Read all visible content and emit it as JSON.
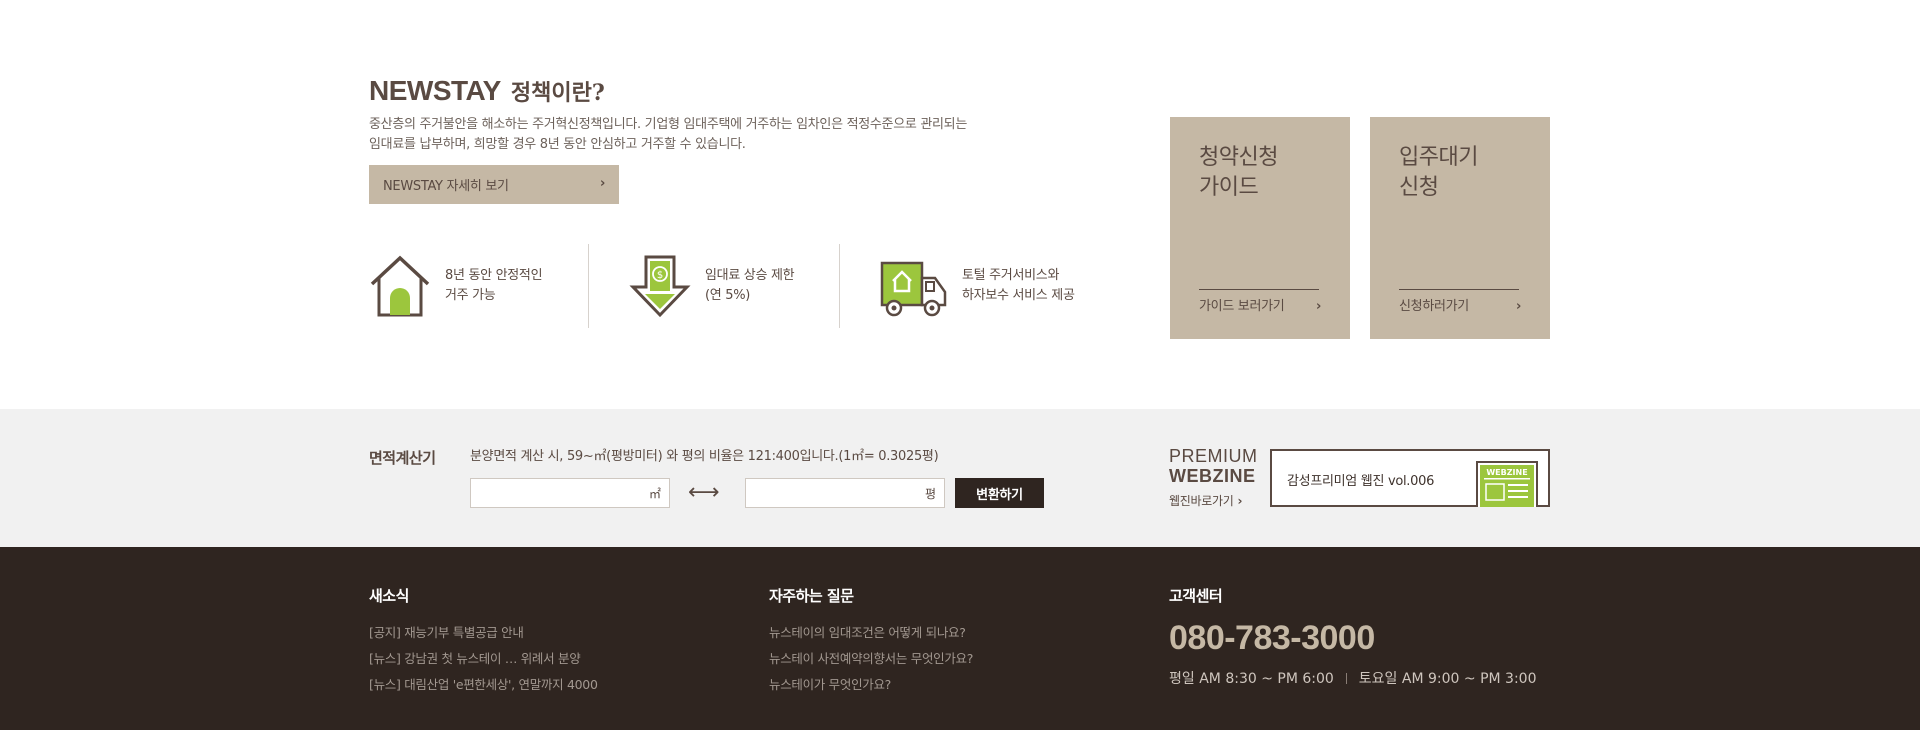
{
  "intro": {
    "brand": "NEWSTAY",
    "subtitle": "정책이란?",
    "desc_line1": "중산층의 주거불안을 해소하는 주거혁신정책입니다. 기업형 임대주택에 거주하는 임차인은 적정수준으로 관리되는",
    "desc_line2": "임대료를 납부하며, 희망할 경우 8년 동안 안심하고 거주할 수 있습니다.",
    "detail_button": "NEWSTAY 자세히 보기",
    "arrow": "›"
  },
  "features": [
    {
      "line1": "8년 동안 안정적인",
      "line2": "거주 가능",
      "icon": "house-icon"
    },
    {
      "line1": "임대료 상승 제한",
      "line2": "(연 5%)",
      "icon": "price-down-arrow-icon"
    },
    {
      "line1": "토털 주거서비스와",
      "line2": "하자보수 서비스 제공",
      "icon": "moving-truck-icon"
    }
  ],
  "cta": [
    {
      "title_line1": "청약신청",
      "title_line2": "가이드",
      "link": "가이드 보러가기"
    },
    {
      "title_line1": "입주대기",
      "title_line2": "신청",
      "link": "신청하러가기"
    }
  ],
  "calculator": {
    "label": "면적계산기",
    "desc": "분양면적 계산 시, 59~㎡(평방미터) 와 평의 비율은 121:400입니다.(1㎡= 0.3025평)",
    "unit_sqm": "㎡",
    "unit_pyeong": "평",
    "arrow": "⟷",
    "convert_button": "변환하기"
  },
  "webzine": {
    "premium": "PREMIUM",
    "webzine": "WEBZINE",
    "link": "웹진바로가기",
    "box_text": "감성프리미엄 웹진 vol.006",
    "thumb_label": "WEBZINE"
  },
  "footer": {
    "news": {
      "title": "새소식",
      "items": [
        "[공지] 재능기부 특별공급 안내",
        "[뉴스] 강남권 첫 뉴스테이 … 위례서 분양",
        "[뉴스] 대림산업 'e편한세상', 연말까지 4000"
      ]
    },
    "faq": {
      "title": "자주하는 질문",
      "items": [
        "뉴스테이의 임대조건은 어떻게 되나요?",
        "뉴스테이 사전예약의향서는 무엇인가요?",
        "뉴스테이가 무엇인가요?"
      ]
    },
    "support": {
      "title": "고객센터",
      "phone": "080-783-3000",
      "weekday": "평일   AM  8:30 ~ PM 6:00",
      "saturday": "토요일   AM  9:00 ~ PM 3:00"
    }
  },
  "colors": {
    "brand_brown": "#5a4a42",
    "beige": "#c5b8a5",
    "green": "#9cc63d",
    "footer_bg": "#2f2520",
    "band_bg": "#f1f1f1"
  }
}
